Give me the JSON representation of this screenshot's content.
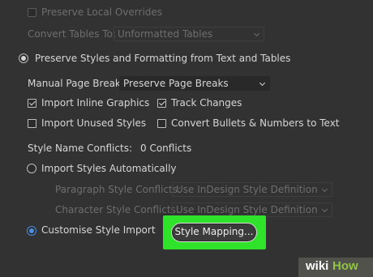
{
  "options": {
    "preserve_local_overrides": {
      "label": "Preserve Local Overrides",
      "checked": false,
      "enabled": false
    },
    "convert_tables_to": {
      "label": "Convert Tables To:",
      "value": "Unformatted Tables",
      "enabled": false
    },
    "preserve_styles": {
      "label": "Preserve Styles and Formatting from Text and Tables",
      "selected": true
    },
    "manual_page_breaks": {
      "label": "Manual Page Breaks:",
      "value": "Preserve Page Breaks"
    },
    "import_inline_graphics": {
      "label": "Import Inline Graphics",
      "checked": true
    },
    "track_changes": {
      "label": "Track Changes",
      "checked": true
    },
    "import_unused_styles": {
      "label": "Import Unused Styles",
      "checked": false
    },
    "convert_bullets": {
      "label": "Convert Bullets & Numbers to Text",
      "checked": false
    },
    "style_name_conflicts": {
      "label": "Style Name Conflicts:",
      "value": "0 Conflicts"
    },
    "import_styles_auto": {
      "label": "Import Styles Automatically",
      "selected": false
    },
    "paragraph_style_conflicts": {
      "label": "Paragraph Style Conflicts:",
      "value": "Use InDesign Style Definition",
      "enabled": false
    },
    "character_style_conflicts": {
      "label": "Character Style Conflicts:",
      "value": "Use InDesign Style Definition",
      "enabled": false
    },
    "customise_style_import": {
      "label": "Customise Style Import",
      "selected": true
    },
    "style_mapping_button": {
      "label": "Style Mapping..."
    }
  },
  "watermark": {
    "wiki": "wiki",
    "how": "How"
  },
  "colors": {
    "background": "#323232",
    "highlight": "#2fe32b",
    "radio_accent": "#4f8fe0",
    "wikihow_green": "#8ec63f"
  }
}
